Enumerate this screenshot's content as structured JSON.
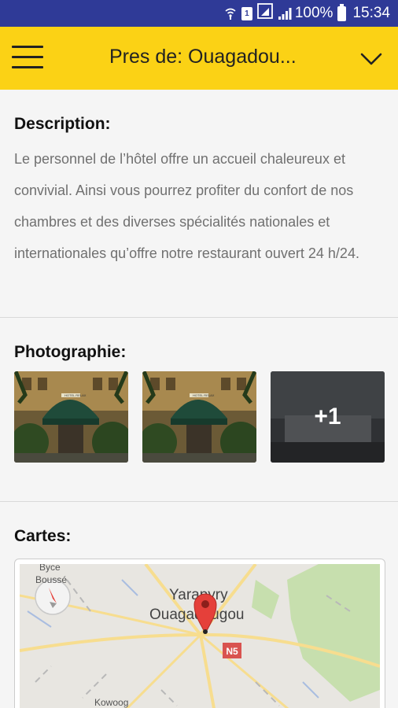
{
  "status_bar": {
    "battery": "100%",
    "time": "15:34",
    "sim_label": "1",
    "icons": [
      "wifi-call-icon",
      "sim-icon",
      "data-icon",
      "signal-icon",
      "battery-icon"
    ]
  },
  "app_bar": {
    "title": "Pres de: Ouagadou...",
    "menu_icon": "hamburger-menu-icon",
    "dropdown_icon": "chevron-down-icon",
    "background": "#fbd215"
  },
  "description": {
    "title": "Description:",
    "text": "Le personnel de l’hôtel offre un accueil chaleureux et convivial. Ainsi vous pourrez profiter du confort de nos chambres et des diverses spécialités nationales et internationales qu’offre notre restaurant ouvert 24 h/24."
  },
  "photos": {
    "title": "Photographie:",
    "more_label": "+1",
    "hotel_sign": "HOTEL RELAX",
    "count_shown": 3
  },
  "map": {
    "title": "Cartes:",
    "labels": {
      "city_top": "Yarapyry",
      "city": "Ouagadougou",
      "village_1": "Byce",
      "village_2": "Boussé",
      "village_3": "Kowoog",
      "road": "N5"
    },
    "colors": {
      "land": "#e8e6e1",
      "park": "#c7dfae",
      "road": "#f7dd8f",
      "pin": "#e5403a"
    }
  }
}
